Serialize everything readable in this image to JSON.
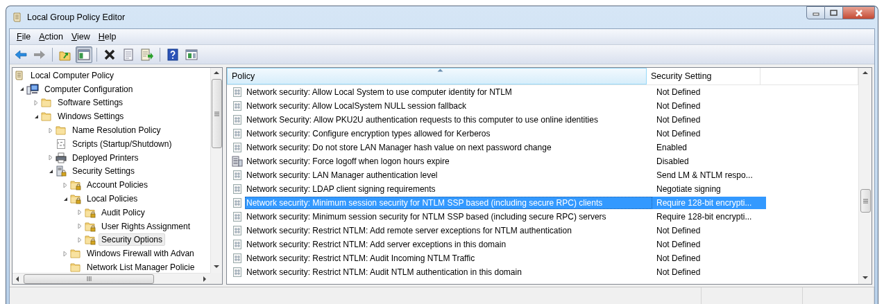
{
  "window": {
    "title": "Local Group Policy Editor"
  },
  "menu": [
    {
      "label": "File"
    },
    {
      "label": "Action"
    },
    {
      "label": "View"
    },
    {
      "label": "Help"
    }
  ],
  "toolbar": [
    [
      {
        "kind": "back",
        "disabled": false,
        "pressed": false
      },
      {
        "kind": "forward",
        "disabled": true,
        "pressed": false
      }
    ],
    [
      {
        "kind": "up-folder",
        "disabled": false,
        "pressed": false
      },
      {
        "kind": "console-tree",
        "disabled": false,
        "pressed": true
      }
    ],
    [
      {
        "kind": "delete",
        "disabled": false,
        "pressed": false
      },
      {
        "kind": "properties",
        "disabled": false,
        "pressed": false
      },
      {
        "kind": "export",
        "disabled": false,
        "pressed": false
      }
    ],
    [
      {
        "kind": "help",
        "disabled": false,
        "pressed": false
      },
      {
        "kind": "action-pane",
        "disabled": false,
        "pressed": false
      }
    ]
  ],
  "tree": {
    "nodes": [
      {
        "label": "Local Computer Policy",
        "kind": "root",
        "selected": false,
        "children": [
          {
            "label": "Computer Configuration",
            "kind": "computer",
            "expanded": true,
            "selected": false,
            "children": [
              {
                "label": "Software Settings",
                "kind": "folder",
                "expanded": false,
                "selected": false
              },
              {
                "label": "Windows Settings",
                "kind": "folder",
                "expanded": true,
                "selected": false,
                "children": [
                  {
                    "label": "Name Resolution Policy",
                    "kind": "folder",
                    "expanded": false,
                    "selected": false
                  },
                  {
                    "label": "Scripts (Startup/Shutdown)",
                    "kind": "script",
                    "selected": false
                  },
                  {
                    "label": "Deployed Printers",
                    "kind": "printer",
                    "expanded": false,
                    "selected": false
                  },
                  {
                    "label": "Security Settings",
                    "kind": "security",
                    "expanded": true,
                    "selected": false,
                    "children": [
                      {
                        "label": "Account Policies",
                        "kind": "locked-folder",
                        "expanded": false,
                        "selected": false
                      },
                      {
                        "label": "Local Policies",
                        "kind": "locked-folder",
                        "expanded": true,
                        "selected": false,
                        "children": [
                          {
                            "label": "Audit Policy",
                            "kind": "locked-folder",
                            "expanded": false,
                            "selected": false
                          },
                          {
                            "label": "User Rights Assignment",
                            "kind": "locked-folder",
                            "expanded": false,
                            "selected": false
                          },
                          {
                            "label": "Security Options",
                            "kind": "locked-folder",
                            "expanded": false,
                            "selected": true
                          }
                        ]
                      },
                      {
                        "label": "Windows Firewall with Advan",
                        "kind": "folder",
                        "expanded": false,
                        "selected": false
                      },
                      {
                        "label": "Network List Manager Policie",
                        "kind": "folder",
                        "selected": false
                      }
                    ]
                  }
                ]
              }
            ]
          }
        ]
      }
    ]
  },
  "list": {
    "columns": [
      {
        "label": "Policy",
        "sorted": true
      },
      {
        "label": "Security Setting",
        "sorted": false
      }
    ],
    "rows": [
      {
        "policy": "Network security: Allow Local System to use computer identity for NTLM",
        "setting": "Not Defined",
        "kind": "setting",
        "selected": false
      },
      {
        "policy": "Network security: Allow LocalSystem NULL session fallback",
        "setting": "Not Defined",
        "kind": "setting",
        "selected": false
      },
      {
        "policy": "Network Security: Allow PKU2U authentication requests to this computer to use online identities",
        "setting": "Not Defined",
        "kind": "setting",
        "selected": false
      },
      {
        "policy": "Network security: Configure encryption types allowed for Kerberos",
        "setting": "Not Defined",
        "kind": "setting",
        "selected": false
      },
      {
        "policy": "Network security: Do not store LAN Manager hash value on next password change",
        "setting": "Enabled",
        "kind": "setting",
        "selected": false
      },
      {
        "policy": "Network security: Force logoff when logon hours expire",
        "setting": "Disabled",
        "kind": "server-setting",
        "selected": false
      },
      {
        "policy": "Network security: LAN Manager authentication level",
        "setting": "Send LM & NTLM respo...",
        "kind": "setting",
        "selected": false
      },
      {
        "policy": "Network security: LDAP client signing requirements",
        "setting": "Negotiate signing",
        "kind": "setting",
        "selected": false
      },
      {
        "policy": "Network security: Minimum session security for NTLM SSP based (including secure RPC) clients",
        "setting": "Require 128-bit encrypti...",
        "kind": "setting",
        "selected": true
      },
      {
        "policy": "Network security: Minimum session security for NTLM SSP based (including secure RPC) servers",
        "setting": "Require 128-bit encrypti...",
        "kind": "setting",
        "selected": false
      },
      {
        "policy": "Network security: Restrict NTLM: Add remote server exceptions for NTLM authentication",
        "setting": "Not Defined",
        "kind": "setting",
        "selected": false
      },
      {
        "policy": "Network security: Restrict NTLM: Add server exceptions in this domain",
        "setting": "Not Defined",
        "kind": "setting",
        "selected": false
      },
      {
        "policy": "Network security: Restrict NTLM: Audit Incoming NTLM Traffic",
        "setting": "Not Defined",
        "kind": "setting",
        "selected": false
      },
      {
        "policy": "Network security: Restrict NTLM: Audit NTLM authentication in this domain",
        "setting": "Not Defined",
        "kind": "setting",
        "selected": false
      }
    ]
  }
}
